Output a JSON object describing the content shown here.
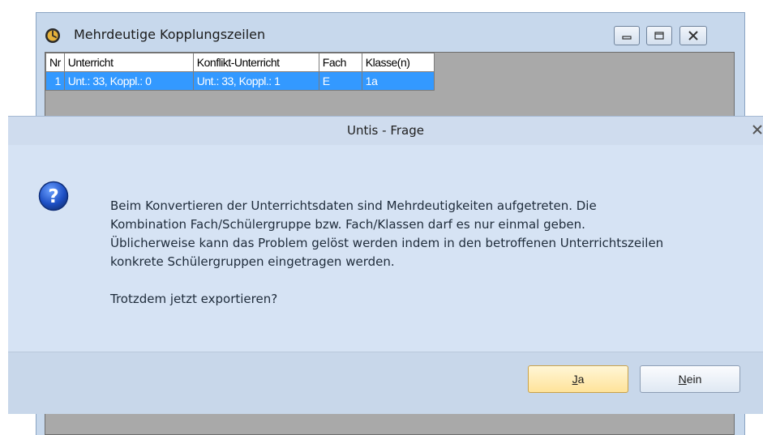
{
  "background_window": {
    "title": "Mehrdeutige Kopplungszeilen",
    "icon": "app-clock-icon",
    "buttons": [
      "minimize",
      "maximize",
      "close"
    ],
    "grid": {
      "columns": [
        "Nr",
        "Unterricht",
        "Konflikt-Unterricht",
        "Fach",
        "Klasse(n)"
      ],
      "rows": [
        {
          "nr": "1",
          "unterricht": "Unt.: 33, Koppl.: 0",
          "konflikt": "Unt.: 33, Koppl.: 1",
          "fach": "E",
          "klassen": "1a"
        }
      ]
    }
  },
  "dialog": {
    "title": "Untis - Frage",
    "icon": "question-icon",
    "message_lines": [
      "Beim Konvertieren der Unterrichtsdaten sind Mehrdeutigkeiten aufgetreten. Die",
      "Kombination Fach/Schülergruppe bzw. Fach/Klassen darf es nur einmal geben.",
      "Üblicherweise kann das Problem gelöst werden indem in den betroffenen Unterrichtszeilen",
      "konkrete Schülergruppen eingetragen werden."
    ],
    "question": "Trotzdem jetzt exportieren?",
    "buttons": {
      "yes": {
        "mnemonic": "J",
        "rest": "a"
      },
      "no": {
        "mnemonic": "N",
        "rest": "ein"
      }
    }
  },
  "colors": {
    "selection": "#3399ff",
    "dialog_body": "#d6e3f4",
    "default_button": "#ffe39a"
  }
}
